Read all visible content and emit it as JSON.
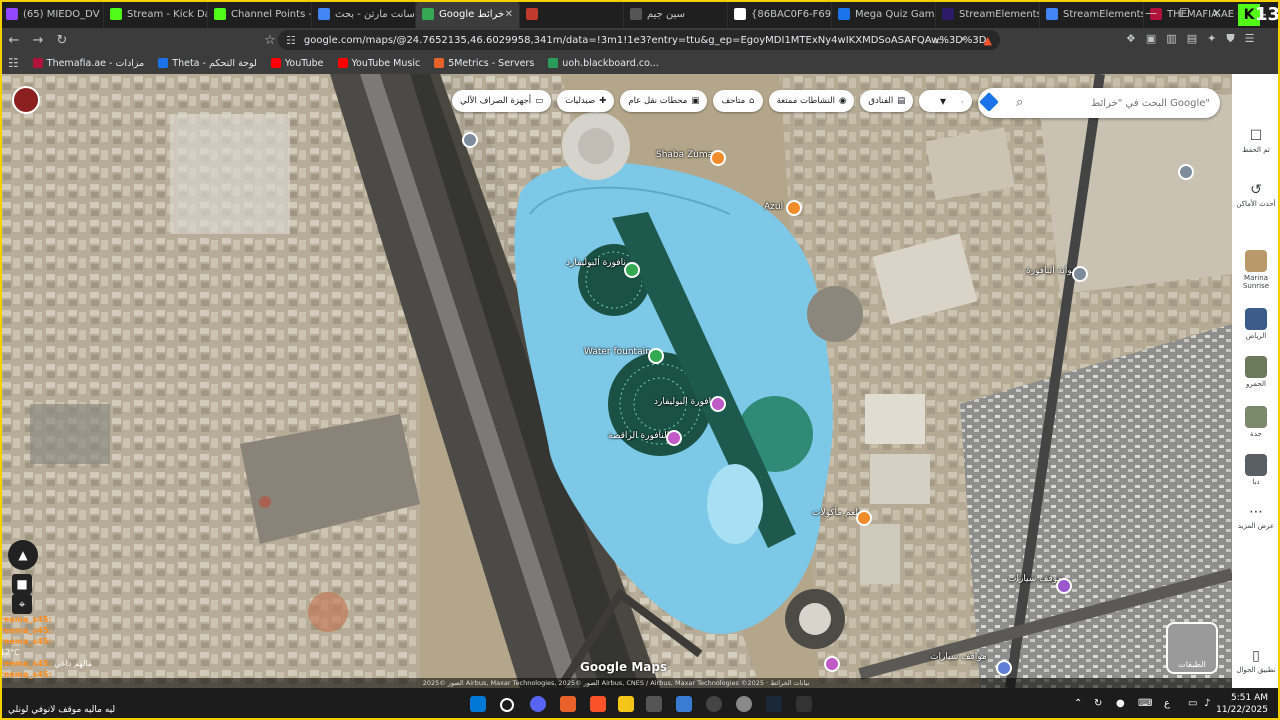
{
  "browser": {
    "tabs": [
      {
        "label": "(65) MIEDO_DV - Tw",
        "icon": "twitch-icon",
        "color": "#9146ff"
      },
      {
        "label": "Stream - Kick Da",
        "icon": "kick-icon",
        "color": "#53fc18"
      },
      {
        "label": "Channel Points - K",
        "icon": "kick-icon",
        "color": "#53fc18"
      },
      {
        "label": "سانت مارتن - بحث",
        "icon": "google-icon",
        "color": "#4285f4"
      },
      {
        "label": "Google خرائط",
        "icon": "google-maps-icon",
        "color": "#34a853",
        "active": true
      },
      {
        "label": "",
        "icon": "app-icon",
        "color": "#c0392b"
      },
      {
        "label": "سین جیم",
        "icon": "blank-icon",
        "color": "#555555"
      },
      {
        "label": "{86BAC0F6-F697-4",
        "icon": "github-icon",
        "color": "#ffffff"
      },
      {
        "label": "Mega Quiz Gaming",
        "icon": "quiz-icon",
        "color": "#1a73e8"
      },
      {
        "label": "StreamElements - C",
        "icon": "streamelements-icon",
        "color": "#2d1b69"
      },
      {
        "label": "StreamElements SE",
        "icon": "google-icon",
        "color": "#4285f4"
      },
      {
        "label": "THEMAFIA.AE - ربية",
        "icon": "mafia-icon",
        "color": "#b0123a"
      }
    ],
    "new_tab": "+",
    "window_controls": {
      "minimize": "—",
      "maximize": "☐",
      "close": "✕"
    },
    "kick_badge": "K",
    "kick_count": "13",
    "url": "google.com/maps/@24.7652135,46.6029958,341m/data=!3m1!1e3?entry=ttu&g_ep=EgoyMDI1MTExNy4wIKXMDSoASAFQAw%3D%3D",
    "bookmarks": [
      {
        "label": "Themafia.ae - مزادات",
        "color": "#b0123a"
      },
      {
        "label": "Theta - لوحة التحكم",
        "color": "#1a73e8"
      },
      {
        "label": "YouTube",
        "color": "#ff0000"
      },
      {
        "label": "YouTube Music",
        "color": "#ff0000"
      },
      {
        "label": "5Metrics - Servers",
        "color": "#e8622a"
      },
      {
        "label": "uoh.blackboard.co...",
        "color": "#2a9d5c"
      }
    ]
  },
  "maps": {
    "search_placeholder": "البحث في \"خرائط Google\"",
    "chips": [
      {
        "label": "مطاعم",
        "icon": "restaurant-icon"
      },
      {
        "label": "الفنادق",
        "icon": "hotel-icon"
      },
      {
        "label": "النشاطات ممتعة",
        "icon": "camera-icon"
      },
      {
        "label": "متاحف",
        "icon": "museum-icon"
      },
      {
        "label": "محطات نقل عام",
        "icon": "transit-icon"
      },
      {
        "label": "صيدليات",
        "icon": "pharmacy-icon"
      },
      {
        "label": "أجهزة الصراف الآلي",
        "icon": "atm-icon"
      }
    ],
    "places": [
      {
        "label": "Shaba Zuma"
      },
      {
        "label": "Azul"
      },
      {
        "label": "نافورة البوليفارد"
      },
      {
        "label": "Water fountain"
      },
      {
        "label": "نافورة البوليفارد"
      },
      {
        "label": "النافورة الراقصة"
      },
      {
        "label": "بوابة النافورة"
      },
      {
        "label": "مطعم مأكولات"
      },
      {
        "label": "موقف سيارات"
      },
      {
        "label": "مواقف سيارات"
      }
    ],
    "layers_label": "الطبقات",
    "brand": "Google Maps",
    "attribution": "الصور ©2025 Airbus, Maxar Technologies, الصور ©2025 Airbus, CNES / Airbus, Maxar Technologies ©2025 · بيانات الخرائط"
  },
  "rail": {
    "items": [
      {
        "label": "تم الحفظ",
        "icon": "bookmark-icon"
      },
      {
        "label": "أحدث الأماكن",
        "icon": "history-icon"
      },
      {
        "label": "Marina Sunrise",
        "icon": "thumb"
      },
      {
        "label": "الرياض",
        "icon": "thumb"
      },
      {
        "label": "الحمرو",
        "icon": "thumb"
      },
      {
        "label": "جدة",
        "icon": "thumb"
      },
      {
        "label": "دبا",
        "icon": "thumb"
      },
      {
        "label": "عرض المزيد",
        "icon": "more-icon"
      },
      {
        "label": "تطبيق الجوال",
        "icon": "phone-icon"
      }
    ]
  },
  "chat": {
    "lines": [
      {
        "user": "reema_s45:",
        "text": ""
      },
      {
        "user": "reema_s45:",
        "text": ""
      },
      {
        "user": "reema_s45:",
        "text": ""
      },
      {
        "user": "reema_s45:",
        "text": "مالهم داعي"
      },
      {
        "user": "reema_s45:",
        "text": ""
      }
    ],
    "bottom_message": "ليه ماليه موقف لانوفي لونلي",
    "temperature": "12°C"
  },
  "taskbar": {
    "time": "5:51 AM",
    "date": "11/22/2025",
    "lang": "ع"
  }
}
